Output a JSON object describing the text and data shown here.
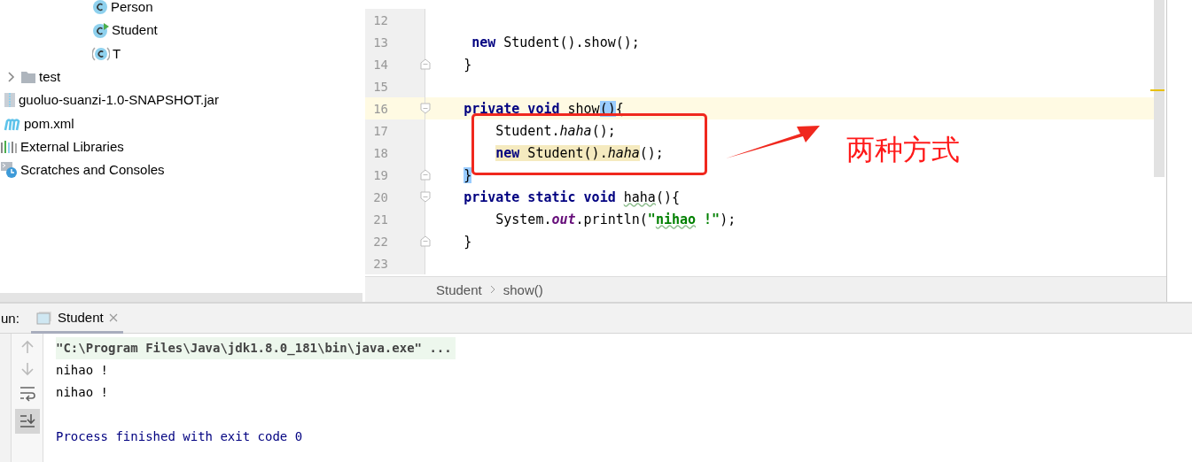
{
  "project_tree": [
    {
      "children": [
        {
          "children": [
            {
              "children": [
                {
                  "children": [
                    {
                      "children": [
                        {
                          "label": "Person",
                          "kind": "class"
                        },
                        {
                          "label": "Student",
                          "kind": "main-class"
                        },
                        {
                          "label": "T",
                          "kind": "parens-class"
                        }
                      ]
                    }
                  ]
                }
              ]
            }
          ]
        },
        {
          "label": "test",
          "kind": "folder",
          "expanded": false
        },
        {
          "label": "guoluo-suanzi-1.0-SNAPSHOT.jar",
          "kind": "jar"
        },
        {
          "label": "pom.xml",
          "kind": "maven"
        }
      ]
    },
    {
      "label": "External Libraries",
      "kind": "libraries"
    },
    {
      "label": "Scratches and Consoles",
      "kind": "scratches"
    }
  ],
  "editor": {
    "lines": [
      {
        "number": "12"
      },
      {
        "number": "13",
        "tokens": [
          {
            "text": "     new",
            "kind": "kw"
          },
          {
            "text": " Student().show();",
            "kind": "plain"
          }
        ]
      },
      {
        "number": "14",
        "fold": {
          "kind": "close"
        },
        "tokens": [
          {
            "text": "    }",
            "kind": "plain"
          }
        ]
      },
      {
        "number": "15"
      },
      {
        "number": "16",
        "current": true,
        "fold": {
          "kind": "open"
        },
        "tokens": [
          {
            "text": "    private void",
            "kind": "kw"
          },
          {
            "text": " show",
            "kind": "plain"
          },
          {
            "text": "()",
            "kind": "brace"
          },
          {
            "text": "{",
            "kind": "plain"
          }
        ]
      },
      {
        "number": "17",
        "tokens": [
          {
            "text": "        Student.",
            "kind": "plain"
          },
          {
            "text": "haha",
            "kind": "static"
          },
          {
            "text": "();",
            "kind": "plain"
          }
        ]
      },
      {
        "number": "18",
        "tokens": [
          {
            "text": "        new",
            "kind": "usage-kw"
          },
          {
            "text": " Student().",
            "kind": "usage-plain"
          },
          {
            "text": "haha",
            "kind": "usage-static"
          },
          {
            "text": "();",
            "kind": "plain"
          }
        ]
      },
      {
        "number": "19",
        "fold": {
          "kind": "close"
        },
        "tokens": [
          {
            "text": "    }",
            "kind": "brace"
          }
        ]
      },
      {
        "number": "20",
        "fold": {
          "kind": "open"
        },
        "tokens": [
          {
            "text": "    private static void ",
            "kind": "kw"
          },
          {
            "text": "haha",
            "kind": "typo"
          },
          {
            "text": "(){",
            "kind": "plain"
          }
        ]
      },
      {
        "number": "21",
        "tokens": [
          {
            "text": "        System.",
            "kind": "plain"
          },
          {
            "text": "out",
            "kind": "field"
          },
          {
            "text": ".println(",
            "kind": "plain"
          },
          {
            "text": "\"",
            "kind": "str"
          },
          {
            "text": "nihao",
            "kind": "str-typo"
          },
          {
            "text": " !\"",
            "kind": "str"
          },
          {
            "text": ");",
            "kind": "plain"
          }
        ]
      },
      {
        "number": "22",
        "fold": {
          "kind": "close"
        },
        "tokens": [
          {
            "text": "    }",
            "kind": "plain"
          }
        ]
      },
      {
        "number": "23"
      }
    ],
    "breadcrumbs": [
      "Student",
      "show()"
    ],
    "annotation": {
      "label": "两种方式"
    }
  },
  "run_panel": {
    "label": "un:",
    "tabs": [
      {
        "label": "Student",
        "selected": true
      }
    ],
    "console": [
      {
        "text": "\"C:\\Program Files\\Java\\jdk1.8.0_181\\bin\\java.exe\" ...",
        "kind": "command"
      },
      {
        "text": "nihao !",
        "kind": "output"
      },
      {
        "text": "nihao !",
        "kind": "output"
      },
      {
        "text": "Process finished with exit code 0",
        "kind": "exit"
      }
    ]
  }
}
